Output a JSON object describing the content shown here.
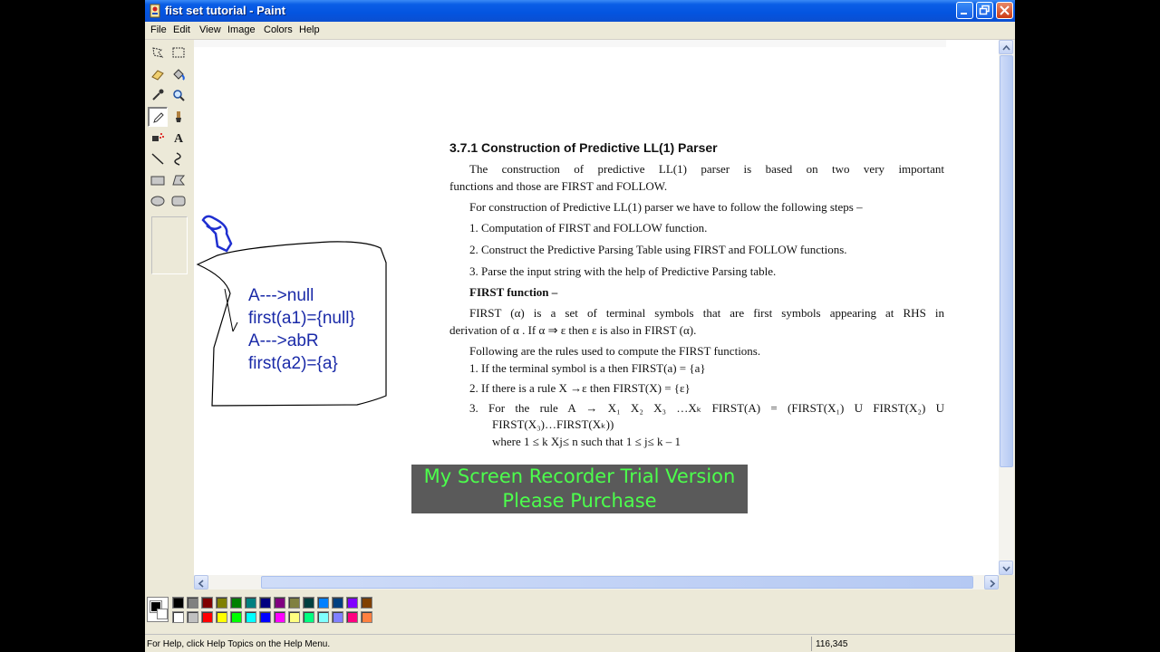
{
  "window": {
    "title": "fist set tutorial - Paint"
  },
  "menu": [
    "File",
    "Edit",
    "View",
    "Image",
    "Colors",
    "Help"
  ],
  "tools": [
    "free-select-icon",
    "rect-select-icon",
    "eraser-icon",
    "fill-icon",
    "color-picker-icon",
    "magnifier-icon",
    "pencil-icon",
    "brush-icon",
    "airbrush-icon",
    "text-icon",
    "line-icon",
    "curve-icon",
    "rectangle-icon",
    "polygon-icon",
    "ellipse-icon",
    "rounded-rect-icon"
  ],
  "document": {
    "heading": "3.7.1 Construction of Predictive LL(1) Parser",
    "para1_line1": "The construction of predictive LL(1) parser is based on two very important",
    "para1_line2": "functions and those are FIRST and FOLLOW.",
    "para2": "For construction of Predictive LL(1) parser we have to follow the following steps –",
    "step1": "1.   Computation of FIRST and FOLLOW function.",
    "step2": "2.   Construct the Predictive Parsing Table using FIRST and FOLLOW functions.",
    "step3": "3.   Parse the input string with the help of Predictive Parsing table.",
    "first_heading": "FIRST function –",
    "first_def_line1": "FIRST (α) is a set of terminal symbols that are first symbols appearing at RHS in",
    "first_def_line2": "derivation of α . If α ⇒ ε then ε is also in FIRST (α).",
    "rules_intro": "Following are the rules used to compute the FIRST functions.",
    "rule1": "1.   If the terminal symbol is a then FIRST(a) = {a}",
    "rule2": "2.   If there is a rule X →ε then FIRST(X) = {ε}",
    "rule3_line1": "3.   For the rule A → X₁ X₂ X₃ …Xₖ FIRST(A) = (FIRST(X₁) U FIRST(X₂) U",
    "rule3_line2": "FIRST(X₃)…FIRST(Xₖ))",
    "rule3_line3": "where 1 ≤ k Xj≤ n such that 1 ≤ j≤ k – 1"
  },
  "handwriting": [
    "A--->null",
    "first(a1)={null}",
    "A--->abR",
    "first(a2)={a}"
  ],
  "watermark": {
    "line1": "My Screen Recorder Trial Version",
    "line2": "Please Purchase"
  },
  "palette": {
    "top": [
      "#000000",
      "#808080",
      "#800000",
      "#808000",
      "#008000",
      "#008080",
      "#000080",
      "#800080",
      "#808040",
      "#004040",
      "#0080ff",
      "#004080",
      "#8000ff",
      "#804000"
    ],
    "bottom": [
      "#ffffff",
      "#c0c0c0",
      "#ff0000",
      "#ffff00",
      "#00ff00",
      "#00ffff",
      "#0000ff",
      "#ff00ff",
      "#ffff80",
      "#00ff80",
      "#80ffff",
      "#8080ff",
      "#ff0080",
      "#ff8040"
    ]
  },
  "status": {
    "help": "For Help, click Help Topics on the Help Menu.",
    "coords": "116,345"
  }
}
